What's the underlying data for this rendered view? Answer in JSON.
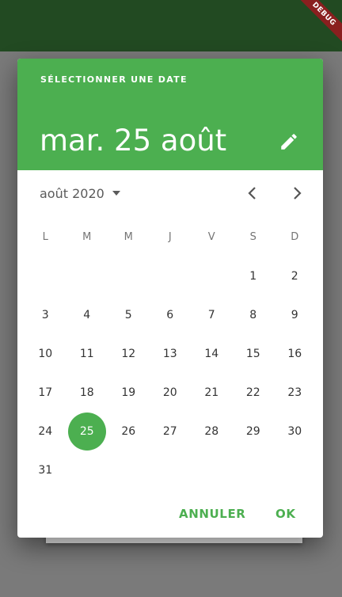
{
  "banner": {
    "label": "DEBUG"
  },
  "header": {
    "help_text": "SÉLECTIONNER UNE DATE",
    "selected_date": "mar. 25 août"
  },
  "month_nav": {
    "month_label": "août 2020"
  },
  "weekdays": [
    "L",
    "M",
    "M",
    "J",
    "V",
    "S",
    "D"
  ],
  "weeks": [
    [
      "",
      "",
      "",
      "",
      "",
      "1",
      "2"
    ],
    [
      "3",
      "4",
      "5",
      "6",
      "7",
      "8",
      "9"
    ],
    [
      "10",
      "11",
      "12",
      "13",
      "14",
      "15",
      "16"
    ],
    [
      "17",
      "18",
      "19",
      "20",
      "21",
      "22",
      "23"
    ],
    [
      "24",
      "25",
      "26",
      "27",
      "28",
      "29",
      "30"
    ],
    [
      "31",
      "",
      "",
      "",
      "",
      "",
      ""
    ]
  ],
  "selected_day": "25",
  "actions": {
    "cancel_label": "ANNULER",
    "ok_label": "OK"
  },
  "colors": {
    "accent": "#4caf50",
    "appbar": "#224a22"
  },
  "icons": {
    "edit": "pencil-icon",
    "dropdown": "caret-down-icon",
    "prev": "chevron-left-icon",
    "next": "chevron-right-icon"
  }
}
